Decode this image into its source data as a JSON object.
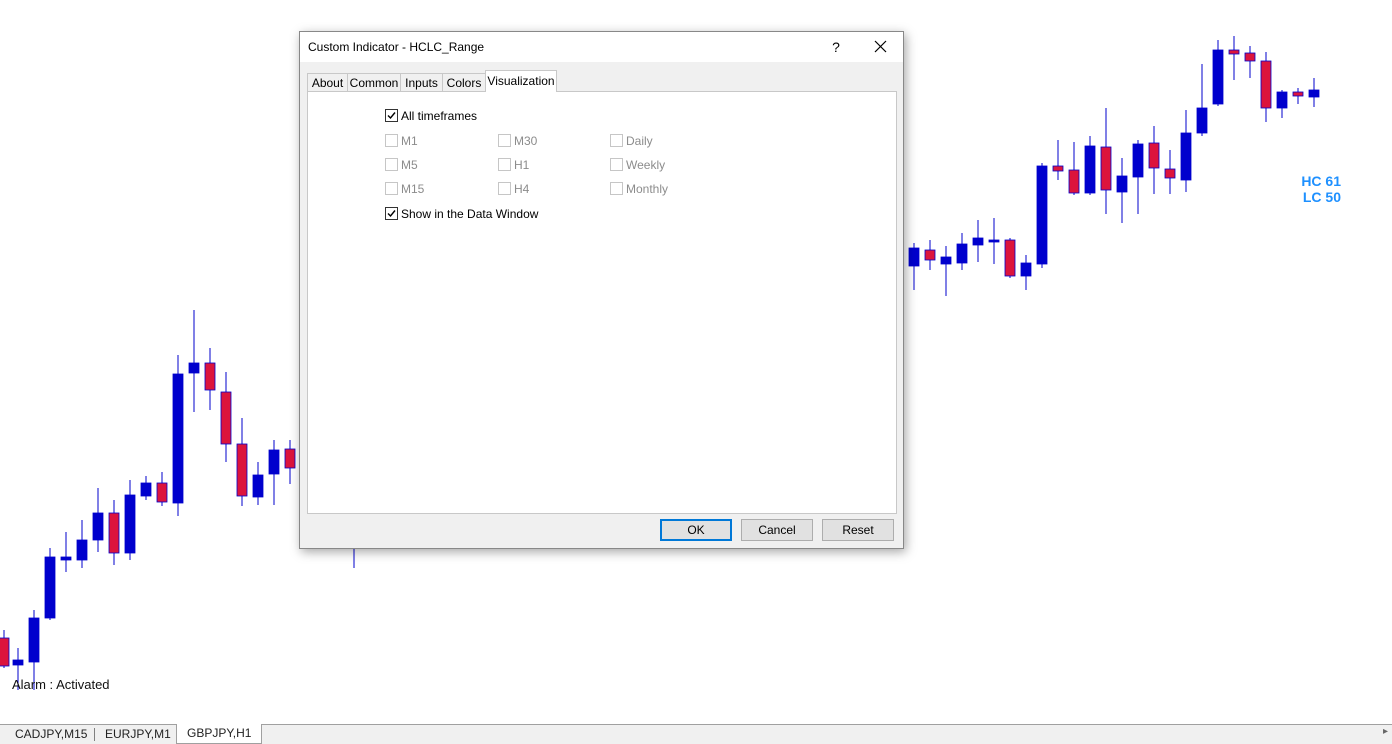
{
  "dialog": {
    "title": "Custom Indicator - HCLC_Range",
    "help": "?",
    "tabs": [
      "About",
      "Common",
      "Inputs",
      "Colors",
      "Visualization"
    ],
    "active_tab": "Visualization",
    "all_timeframes": {
      "label": "All timeframes",
      "checked": true
    },
    "timeframes": [
      {
        "label": "M1"
      },
      {
        "label": "M5"
      },
      {
        "label": "M15"
      },
      {
        "label": "M30"
      },
      {
        "label": "H1"
      },
      {
        "label": "H4"
      },
      {
        "label": "Daily"
      },
      {
        "label": "Weekly"
      },
      {
        "label": "Monthly"
      }
    ],
    "show_data_window": {
      "label": "Show in the Data Window",
      "checked": true
    },
    "buttons": {
      "ok": "OK",
      "cancel": "Cancel",
      "reset": "Reset"
    }
  },
  "chart": {
    "hc_label": "HC 61",
    "lc_label": "LC 50",
    "alarm_text": "Alarm : Activated",
    "bull_color": "#0000cd",
    "bear_color": "#dc143c"
  },
  "symbol_tabs": [
    {
      "label": "CADJPY,M15",
      "active": false
    },
    {
      "label": "EURJPY,M1",
      "active": false
    },
    {
      "label": "GBPJPY,H1",
      "active": true
    }
  ]
}
